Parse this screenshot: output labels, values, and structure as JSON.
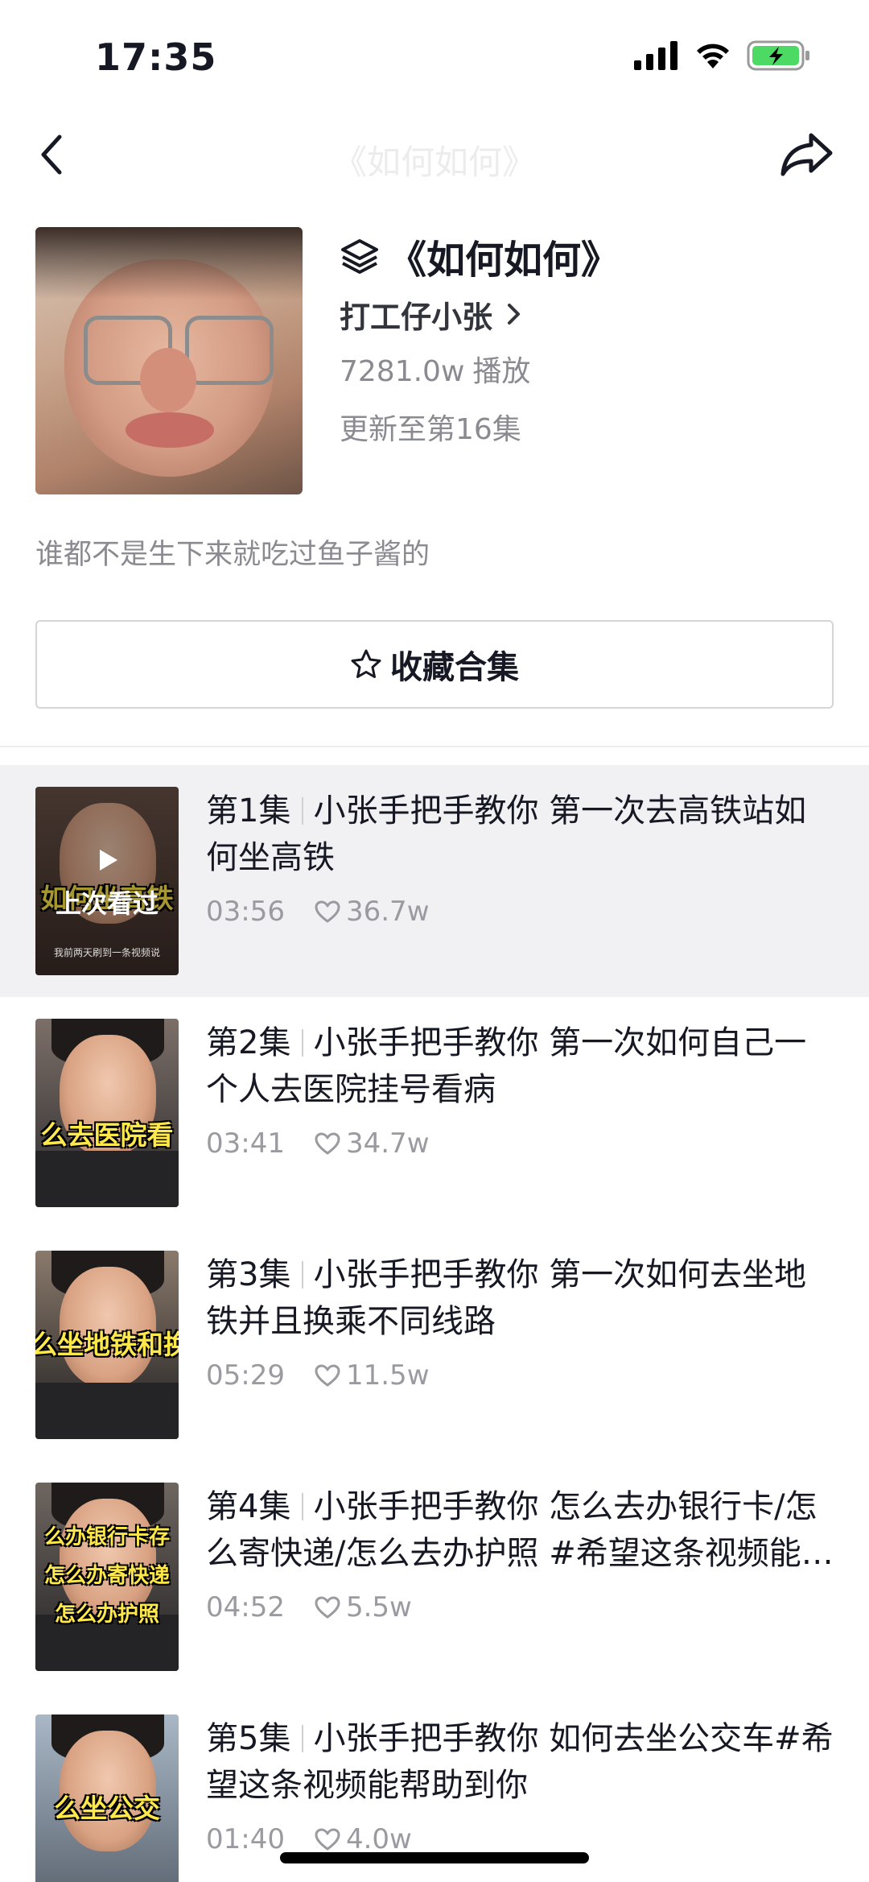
{
  "status_bar": {
    "time": "17:35"
  },
  "nav": {
    "title": "《如何如何》"
  },
  "collection": {
    "title": "《如何如何》",
    "author": "打工仔小张",
    "plays_count": "7281.0w",
    "plays_label": "播放",
    "update_text": "更新至第16集",
    "description": "谁都不是生下来就吃过鱼子酱的",
    "favorite_label": "收藏合集"
  },
  "episodes": [
    {
      "number": "第1集",
      "title": "小张手把手教你 第一次去高铁站如何坐高铁",
      "duration": "03:56",
      "likes": "36.7w",
      "thumb_caption": "如何坐高铁",
      "watched_label": "上次看过",
      "thumb_subtext": "我前两天刷到一条视频说"
    },
    {
      "number": "第2集",
      "title": "小张手把手教你 第一次如何自己一个人去医院挂号看病",
      "duration": "03:41",
      "likes": "34.7w",
      "thumb_caption": "么去医院看"
    },
    {
      "number": "第3集",
      "title": "小张手把手教你 第一次如何去坐地铁并且换乘不同线路",
      "duration": "05:29",
      "likes": "11.5w",
      "thumb_caption": "么坐地铁和换"
    },
    {
      "number": "第4集",
      "title": "小张手把手教你 怎么去办银行卡/怎么寄快递/怎么去办护照 #希望这条视频能帮助到你",
      "duration": "04:52",
      "likes": "5.5w",
      "thumb_caption_lines": [
        "么办银行卡存",
        "怎么办寄快递",
        "怎么办护照"
      ]
    },
    {
      "number": "第5集",
      "title": "小张手把手教你 如何去坐公交车#希望这条视频能帮助到你",
      "duration": "01:40",
      "likes": "4.0w",
      "thumb_caption": "么坐公交"
    }
  ],
  "colors": {
    "text_primary": "#161823",
    "text_secondary": "#8a8b91",
    "active_row_bg": "#f1f1f3",
    "battery_green": "#4cd964"
  }
}
